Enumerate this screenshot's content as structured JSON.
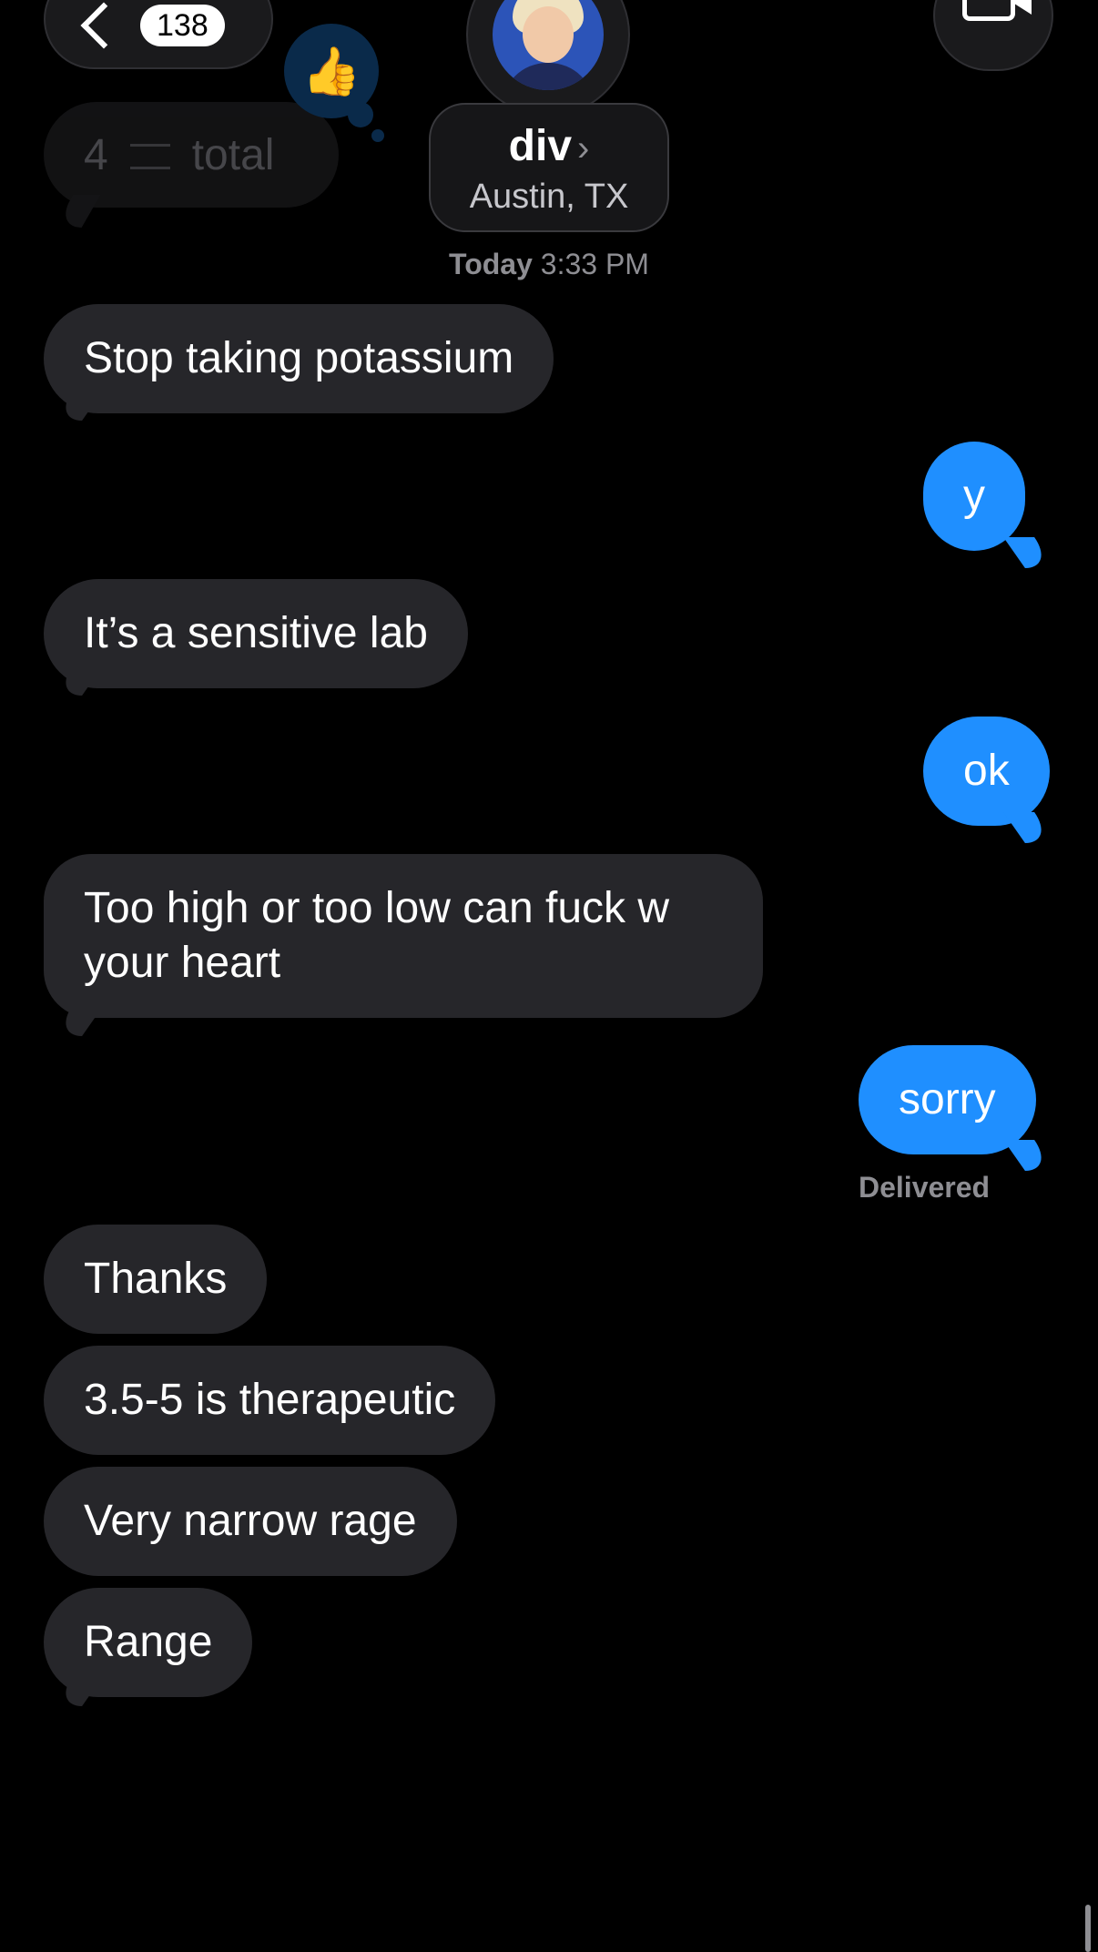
{
  "header": {
    "back_count": "138",
    "contact_name": "div",
    "contact_location": "Austin, TX"
  },
  "faded_message": {
    "number": "4",
    "word": "total"
  },
  "timestamp": {
    "day": "Today",
    "time": "3:33 PM"
  },
  "messages": [
    {
      "direction": "received",
      "text": "Stop taking potassium"
    },
    {
      "direction": "sent",
      "text": "y"
    },
    {
      "direction": "received",
      "text": "It’s a sensitive lab"
    },
    {
      "direction": "sent",
      "text": "ok"
    },
    {
      "direction": "received",
      "text_line1": "Too high or too low can fuck w",
      "text_line2": "your heart"
    },
    {
      "direction": "sent",
      "text": "sorry"
    },
    {
      "direction": "received",
      "text": "Thanks"
    },
    {
      "direction": "received",
      "text": "3.5-5 is therapeutic"
    },
    {
      "direction": "received",
      "text": "Very narrow rage"
    },
    {
      "direction": "received",
      "text": "Range"
    }
  ],
  "status": {
    "delivered": "Delivered"
  },
  "colors": {
    "sent_bubble": "#1f8fff",
    "received_bubble": "#26262a",
    "background": "#000000"
  },
  "icons": [
    "back-chevron-icon",
    "chevron-right-icon",
    "video-camera-icon",
    "thumbs-up-icon"
  ]
}
